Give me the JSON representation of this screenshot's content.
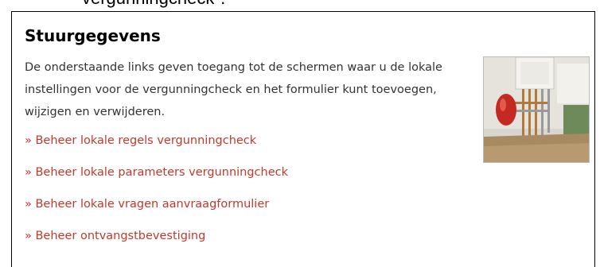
{
  "top_text": "vergunningcheck\".",
  "panel": {
    "title": "Stuurgegevens",
    "intro": "De onderstaande links geven toegang tot de schermen waar u de lokale instellingen voor de vergunningcheck en het formulier kunt toevoegen, wijzigen en verwijderen.",
    "links": [
      {
        "label": "» Beheer lokale regels vergunningcheck"
      },
      {
        "label": "» Beheer lokale parameters vergunningcheck"
      },
      {
        "label": "» Beheer lokale vragen aanvraagformulier"
      },
      {
        "label": "» Beheer ontvangstbevestiging"
      }
    ]
  },
  "colors": {
    "link": "#c0392b",
    "border": "#000000",
    "text": "#333333"
  },
  "photo_icon": "boiler-photo"
}
